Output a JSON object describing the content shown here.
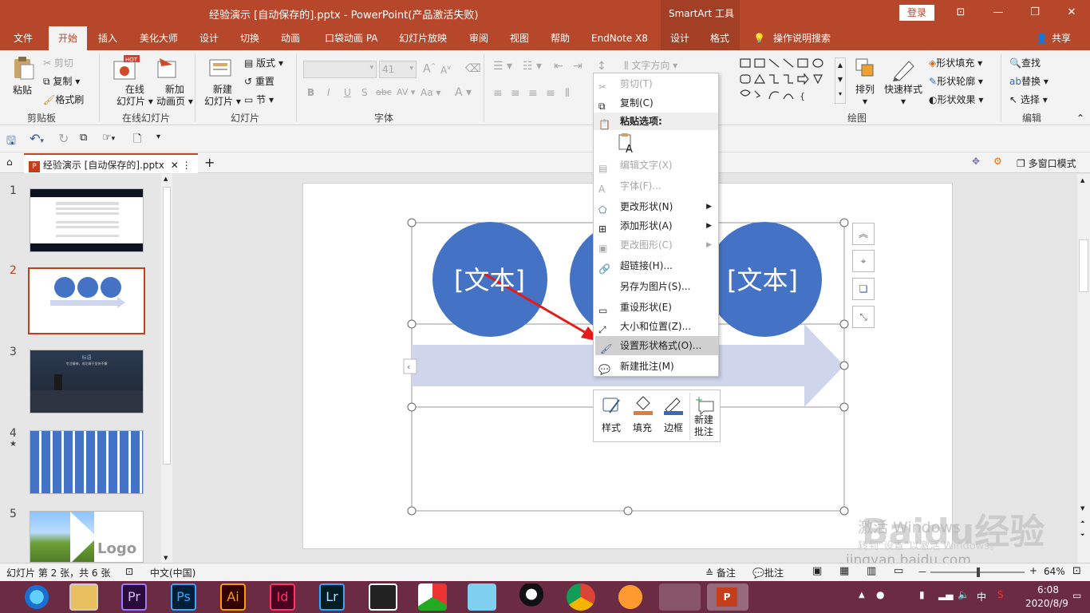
{
  "window": {
    "title": "经验演示 [自动保存的].pptx  -  PowerPoint(产品激活失败)",
    "context_title": "SmartArt 工具",
    "login": "登录",
    "minimize": "—",
    "restore": "❐",
    "close": "✕",
    "ribbon_display": "⊡"
  },
  "tabs": [
    {
      "label": "文件"
    },
    {
      "label": "开始"
    },
    {
      "label": "插入"
    },
    {
      "label": "美化大师"
    },
    {
      "label": "设计"
    },
    {
      "label": "切换"
    },
    {
      "label": "动画"
    },
    {
      "label": "口袋动画 PA"
    },
    {
      "label": "幻灯片放映"
    },
    {
      "label": "审阅"
    },
    {
      "label": "视图"
    },
    {
      "label": "帮助"
    },
    {
      "label": "EndNote X8"
    },
    {
      "label": "设计"
    },
    {
      "label": "格式"
    }
  ],
  "search_label": "操作说明搜索",
  "share_label": "共享",
  "ribbon": {
    "clipboard": {
      "paste": "粘贴",
      "cut": "剪切",
      "copy": "复制",
      "format_painter": "格式刷",
      "group": "剪贴板"
    },
    "online_slides": {
      "online": "在线",
      "online2": "幻灯片",
      "newanim": "新加",
      "newanim2": "动画页",
      "group": "在线幻灯片"
    },
    "slides": {
      "new": "新建",
      "new2": "幻灯片",
      "layout": "版式",
      "reset": "重置",
      "section": "节",
      "group": "幻灯片"
    },
    "font": {
      "size": "41",
      "group": "字体",
      "bold": "B",
      "italic": "I",
      "underline": "U",
      "strike": "S",
      "shadow": "abc",
      "spacing": "AV",
      "case": "Aa",
      "color": "A",
      "grow": "A",
      "shrink": "A"
    },
    "paragraph": {
      "text_direction": "文字方向"
    },
    "drawing": {
      "arrange": "排列",
      "quick_styles": "快速样式",
      "fill": "形状填充",
      "outline": "形状轮廓",
      "effects": "形状效果",
      "group": "绘图"
    },
    "editing": {
      "find": "查找",
      "replace": "替换",
      "select": "选择",
      "group": "编辑"
    }
  },
  "doc_tab": {
    "label": "经验演示 [自动保存的].pptx",
    "add": "+",
    "multiwindow": "多窗口模式"
  },
  "thumbnails": [
    {
      "num": "1",
      "star": ""
    },
    {
      "num": "2",
      "star": ""
    },
    {
      "num": "3",
      "star": "",
      "title": "标语",
      "subtitle": "专注精神，成功源于坚持不懈"
    },
    {
      "num": "4",
      "star": "★"
    },
    {
      "num": "5",
      "star": "",
      "logo": "Logo"
    }
  ],
  "slide": {
    "text_left": "[文本]",
    "text_right": "[文本]"
  },
  "context_menu": [
    {
      "label": "剪切(T)",
      "disabled": true,
      "icon": "scissors-icon"
    },
    {
      "label": "复制(C)",
      "disabled": false,
      "icon": "copy-icon"
    },
    {
      "label": "粘贴选项:",
      "disabled": false,
      "header": true,
      "icon": "paste-icon"
    },
    {
      "label": "编辑文字(X)",
      "disabled": true,
      "icon": "edit-text-icon"
    },
    {
      "label": "字体(F)...",
      "disabled": true,
      "icon": "font-icon"
    },
    {
      "label": "更改形状(N)",
      "disabled": false,
      "submenu": true,
      "icon": "change-shape-icon"
    },
    {
      "label": "添加形状(A)",
      "disabled": false,
      "submenu": true,
      "icon": "add-shape-icon"
    },
    {
      "label": "更改图形(C)",
      "disabled": true,
      "submenu": true,
      "icon": "change-graphic-icon"
    },
    {
      "label": "超链接(H)...",
      "disabled": false,
      "icon": "hyperlink-icon"
    },
    {
      "label": "另存为图片(S)...",
      "disabled": false,
      "icon": ""
    },
    {
      "label": "重设形状(E)",
      "disabled": false,
      "icon": "reset-shape-icon"
    },
    {
      "label": "大小和位置(Z)...",
      "disabled": false,
      "icon": "size-position-icon"
    },
    {
      "label": "设置形状格式(O)...",
      "disabled": false,
      "highlighted": true,
      "icon": "format-shape-icon"
    },
    {
      "label": "新建批注(M)",
      "disabled": false,
      "icon": "new-comment-icon"
    }
  ],
  "mini_toolbar": {
    "style": "样式",
    "fill": "填充",
    "border": "边框",
    "comment": "新建",
    "comment2": "批注"
  },
  "statusbar": {
    "slide_info": "幻灯片 第 2 张，共 6 张",
    "language": "中文(中国)",
    "notes": "备注",
    "comments": "批注",
    "zoom": "64%",
    "zoom_minus": "－",
    "zoom_plus": "+"
  },
  "watermark": {
    "activate": "激活 Windows",
    "activate2": "转到\"设置\"以激活 Windows。",
    "site": "jingyan.baidu.com",
    "brand": "Baidu经验"
  },
  "taskbar": {
    "time": "6:08",
    "date": "2020/8/9",
    "ime": "中",
    "apps": [
      "Pr",
      "Ps",
      "Ai",
      "Id",
      "Lr"
    ]
  },
  "colors": {
    "accent": "#b7472a",
    "circle": "#4472c4",
    "arrow": "#cfd5ea",
    "taskbar": "#6b2b43",
    "red_arrow": "#e31b1b"
  }
}
